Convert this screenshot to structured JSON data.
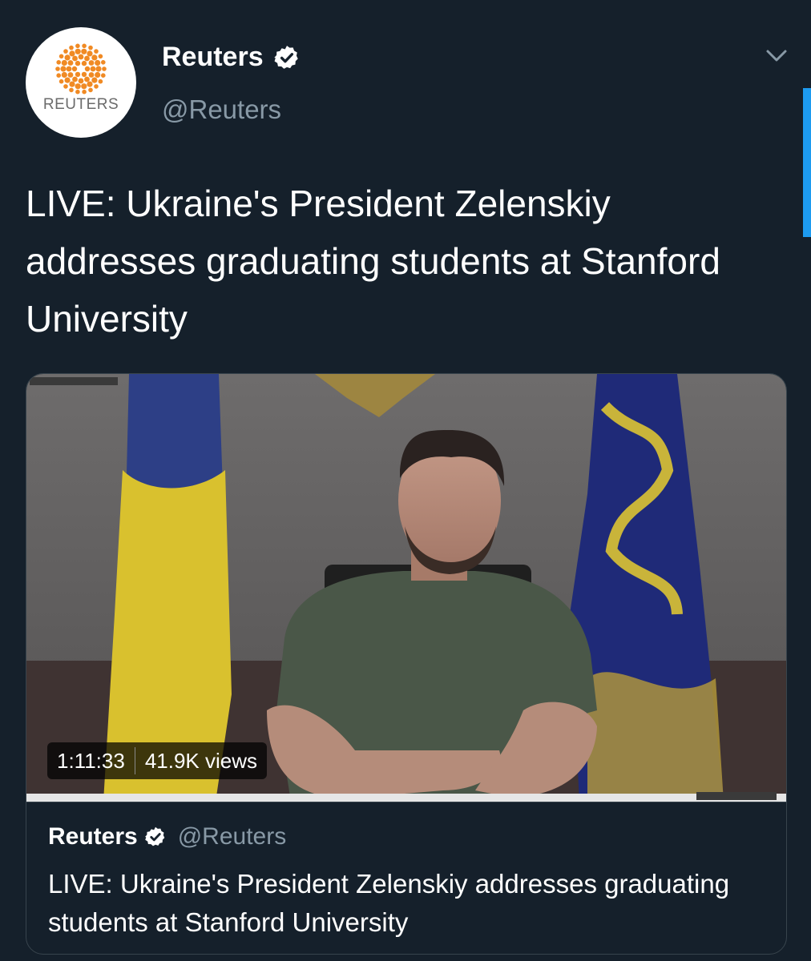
{
  "author": {
    "display_name": "Reuters",
    "handle": "@Reuters",
    "avatar_label": "REUTERS",
    "verified": true
  },
  "tweet": {
    "text": "LIVE: Ukraine's President Zelenskiy addresses graduating students at Stanford University"
  },
  "video": {
    "duration": "1:11:33",
    "views": "41.9K views"
  },
  "quoted": {
    "display_name": "Reuters",
    "handle": "@Reuters",
    "text": "LIVE: Ukraine's President Zelenskiy addresses graduating students at Stanford University"
  },
  "icons": {
    "verified": "verified-badge-icon",
    "menu": "chevron-down-icon"
  },
  "colors": {
    "background": "#15202b",
    "secondary_text": "#8899a6",
    "border": "#38444d",
    "accent": "#1d9bf0",
    "reuters_orange": "#f08a24"
  }
}
